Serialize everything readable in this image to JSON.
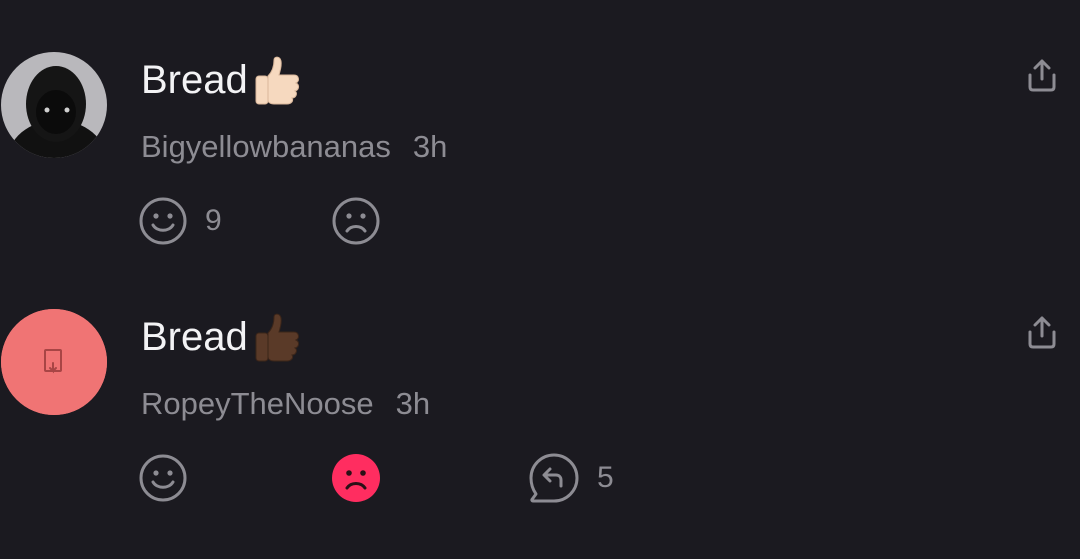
{
  "comments": [
    {
      "text": "Bread",
      "emoji": "thumbs-up-light-skin",
      "username": "Bigyellowbananas",
      "time": "3h",
      "like_count": "9",
      "dislike_active": false,
      "avatar_color": "#b7b6ba"
    },
    {
      "text": "Bread",
      "emoji": "thumbs-up-dark-skin",
      "username": "RopeyTheNoose",
      "time": "3h",
      "reply_count": "5",
      "dislike_active": true,
      "avatar_color": "#f07474"
    }
  ],
  "colors": {
    "background": "#1b1a20",
    "icon_gray": "#8d8c93",
    "dislike_active": "#ff2d60"
  }
}
